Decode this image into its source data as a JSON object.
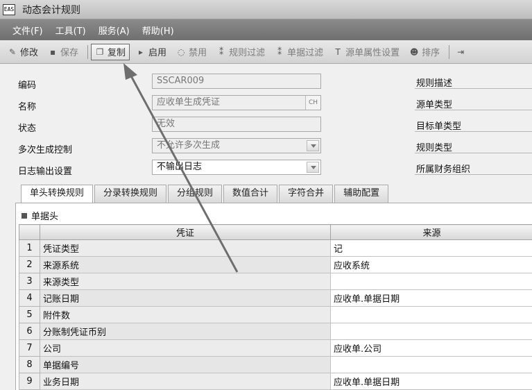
{
  "window": {
    "app_icon_text": "EAS",
    "title": "动态会计规则"
  },
  "menu": [
    "文件(F)",
    "工具(T)",
    "服务(A)",
    "帮助(H)"
  ],
  "toolbar": {
    "edit": "修改",
    "save": "保存",
    "copy": "复制",
    "enable": "启用",
    "disable": "禁用",
    "rule_filter": "规则过滤",
    "doc_filter": "单据过滤",
    "source_attr": "源单属性设置",
    "sort": "排序"
  },
  "form": {
    "code_label": "编码",
    "code_value": "SSCAR009",
    "name_label": "名称",
    "name_value": "应收单生成凭证",
    "name_lang": "CH",
    "status_label": "状态",
    "status_value": "无效",
    "multi_label": "多次生成控制",
    "multi_value": "不允许多次生成",
    "log_label": "日志输出设置",
    "log_value": "不输出日志",
    "rule_desc_label": "规则描述",
    "source_type_label": "源单类型",
    "target_type_label": "目标单类型",
    "rule_type_label": "规则类型",
    "org_label": "所属财务组织"
  },
  "tabs": [
    "单头转换规则",
    "分录转换规则",
    "分组规则",
    "数值合计",
    "字符合并",
    "辅助配置"
  ],
  "section_title": "单据头",
  "grid": {
    "headers": [
      "凭证",
      "来源"
    ],
    "rows": [
      {
        "num": "1",
        "voucher": "凭证类型",
        "source": "记"
      },
      {
        "num": "2",
        "voucher": "来源系统",
        "source": "应收系统"
      },
      {
        "num": "3",
        "voucher": "来源类型",
        "source": ""
      },
      {
        "num": "4",
        "voucher": "记账日期",
        "source": "应收单.单据日期"
      },
      {
        "num": "5",
        "voucher": "附件数",
        "source": ""
      },
      {
        "num": "6",
        "voucher": "分账制凭证币别",
        "source": ""
      },
      {
        "num": "7",
        "voucher": "公司",
        "source": "应收单.公司"
      },
      {
        "num": "8",
        "voucher": "单据编号",
        "source": ""
      },
      {
        "num": "9",
        "voucher": "业务日期",
        "source": "应收单.单据日期"
      }
    ]
  }
}
